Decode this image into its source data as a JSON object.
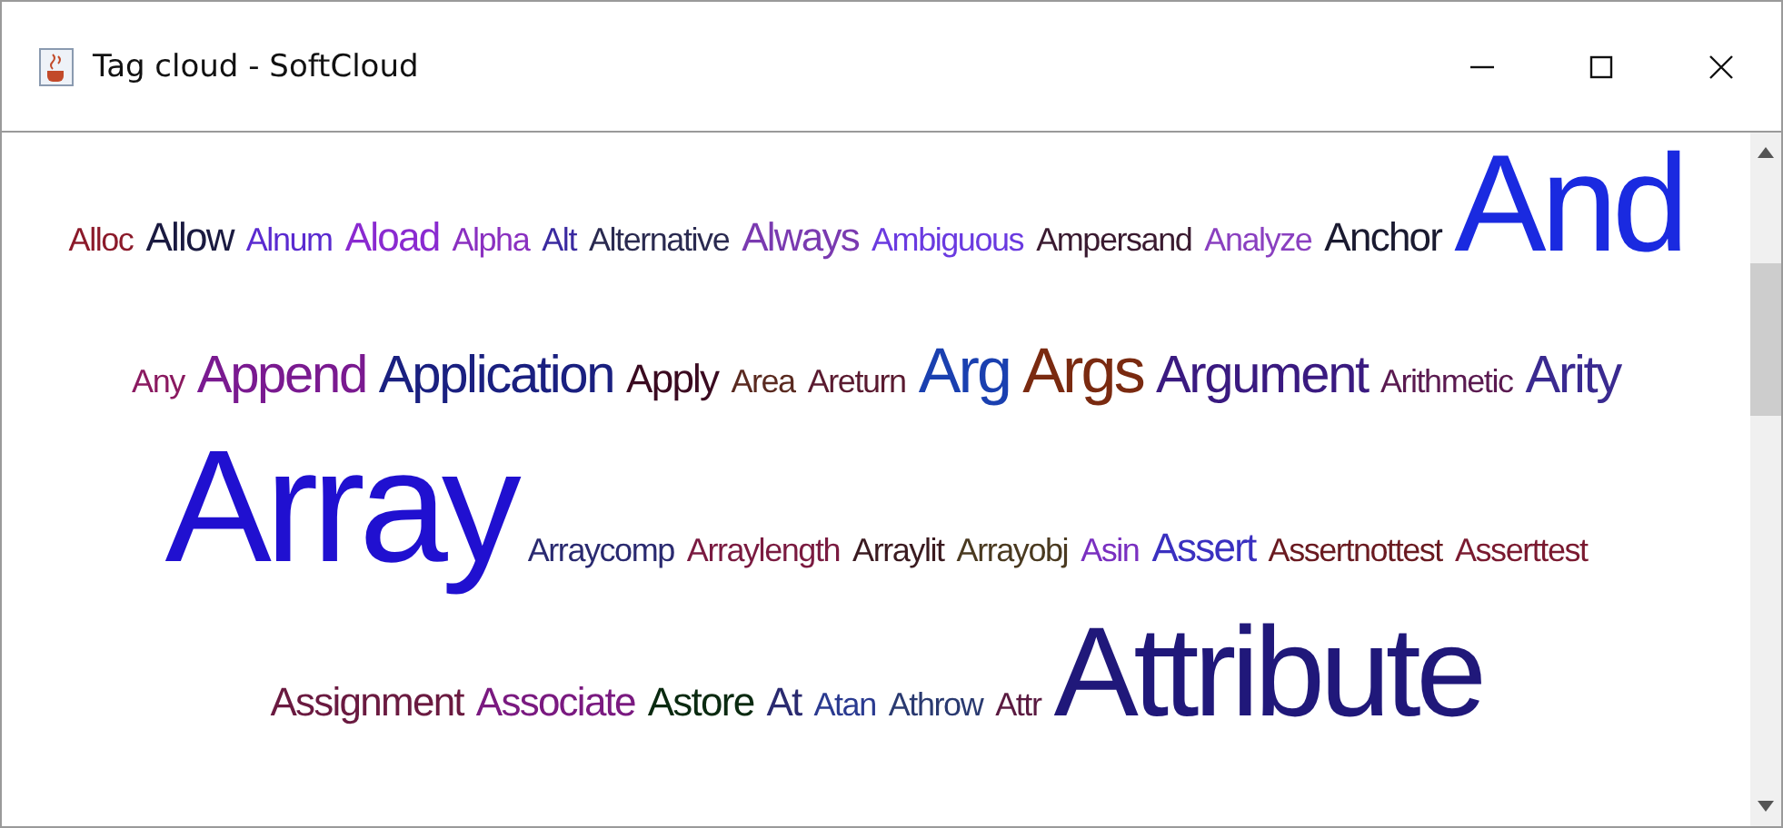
{
  "window": {
    "title": "Tag cloud - SoftCloud"
  },
  "rows": [
    {
      "tags": [
        {
          "text": "Alloc",
          "kind": "small",
          "color": "#8b1a2a"
        },
        {
          "text": "Allow",
          "kind": "medium",
          "color": "#1a1a40"
        },
        {
          "text": "Alnum",
          "kind": "small",
          "color": "#5a2ad0"
        },
        {
          "text": "Aload",
          "kind": "medium",
          "color": "#8a2ad0"
        },
        {
          "text": "Alpha",
          "kind": "small",
          "color": "#8a30c0"
        },
        {
          "text": "Alt",
          "kind": "small",
          "color": "#3a2aa0"
        },
        {
          "text": "Alternative",
          "kind": "small",
          "color": "#2a2a50"
        },
        {
          "text": "Always",
          "kind": "medium",
          "color": "#7a3ab0"
        },
        {
          "text": "Ambiguous",
          "kind": "small",
          "color": "#6a3ae0"
        },
        {
          "text": "Ampersand",
          "kind": "small",
          "color": "#3a1a30"
        },
        {
          "text": "Analyze",
          "kind": "small",
          "color": "#8a40c0"
        },
        {
          "text": "Anchor",
          "kind": "medium",
          "color": "#1a1a30"
        },
        {
          "text": "And",
          "kind": "giant",
          "color": "#1a2ae0"
        }
      ]
    },
    {
      "tags": [
        {
          "text": "Any",
          "kind": "small",
          "color": "#8a1a60"
        },
        {
          "text": "Append",
          "kind": "large",
          "color": "#7a1a90"
        },
        {
          "text": "Application",
          "kind": "large",
          "color": "#1a2080"
        },
        {
          "text": "Apply",
          "kind": "medium",
          "color": "#3a0a20"
        },
        {
          "text": "Area",
          "kind": "small",
          "color": "#5a2a20"
        },
        {
          "text": "Areturn",
          "kind": "small",
          "color": "#5a1a30"
        },
        {
          "text": "Arg",
          "kind": "xlarge",
          "color": "#1a40b0"
        },
        {
          "text": "Args",
          "kind": "xlarge",
          "color": "#7a2a10"
        },
        {
          "text": "Argument",
          "kind": "large",
          "color": "#3a1a80"
        },
        {
          "text": "Arithmetic",
          "kind": "small",
          "color": "#5a1a50"
        },
        {
          "text": "Arity",
          "kind": "large",
          "color": "#3a2a90"
        }
      ]
    },
    {
      "tags": [
        {
          "text": "Array",
          "kind": "colossal",
          "color": "#2010d0"
        },
        {
          "text": "Arraycomp",
          "kind": "small",
          "color": "#2a2a70"
        },
        {
          "text": "Arraylength",
          "kind": "small",
          "color": "#7a1a40"
        },
        {
          "text": "Arraylit",
          "kind": "small",
          "color": "#3a1a20"
        },
        {
          "text": "Arrayobj",
          "kind": "small",
          "color": "#4a3a20"
        },
        {
          "text": "Asin",
          "kind": "small",
          "color": "#7a30c0"
        },
        {
          "text": "Assert",
          "kind": "medium",
          "color": "#3a30c0"
        },
        {
          "text": "Assertnottest",
          "kind": "small",
          "color": "#6a1a20"
        },
        {
          "text": "Asserttest",
          "kind": "small",
          "color": "#7a1a30"
        }
      ]
    },
    {
      "tags": [
        {
          "text": "Assignment",
          "kind": "medium",
          "color": "#6a1a40"
        },
        {
          "text": "Associate",
          "kind": "medium",
          "color": "#7a1a80"
        },
        {
          "text": "Astore",
          "kind": "medium",
          "color": "#0a2a10"
        },
        {
          "text": "At",
          "kind": "medium",
          "color": "#2a2a70"
        },
        {
          "text": "Atan",
          "kind": "small",
          "color": "#2a3a90"
        },
        {
          "text": "Athrow",
          "kind": "small",
          "color": "#2a3a70"
        },
        {
          "text": "Attr",
          "kind": "small",
          "color": "#5a1a40"
        },
        {
          "text": "Attribute",
          "kind": "huge",
          "color": "#20187a"
        }
      ]
    }
  ]
}
